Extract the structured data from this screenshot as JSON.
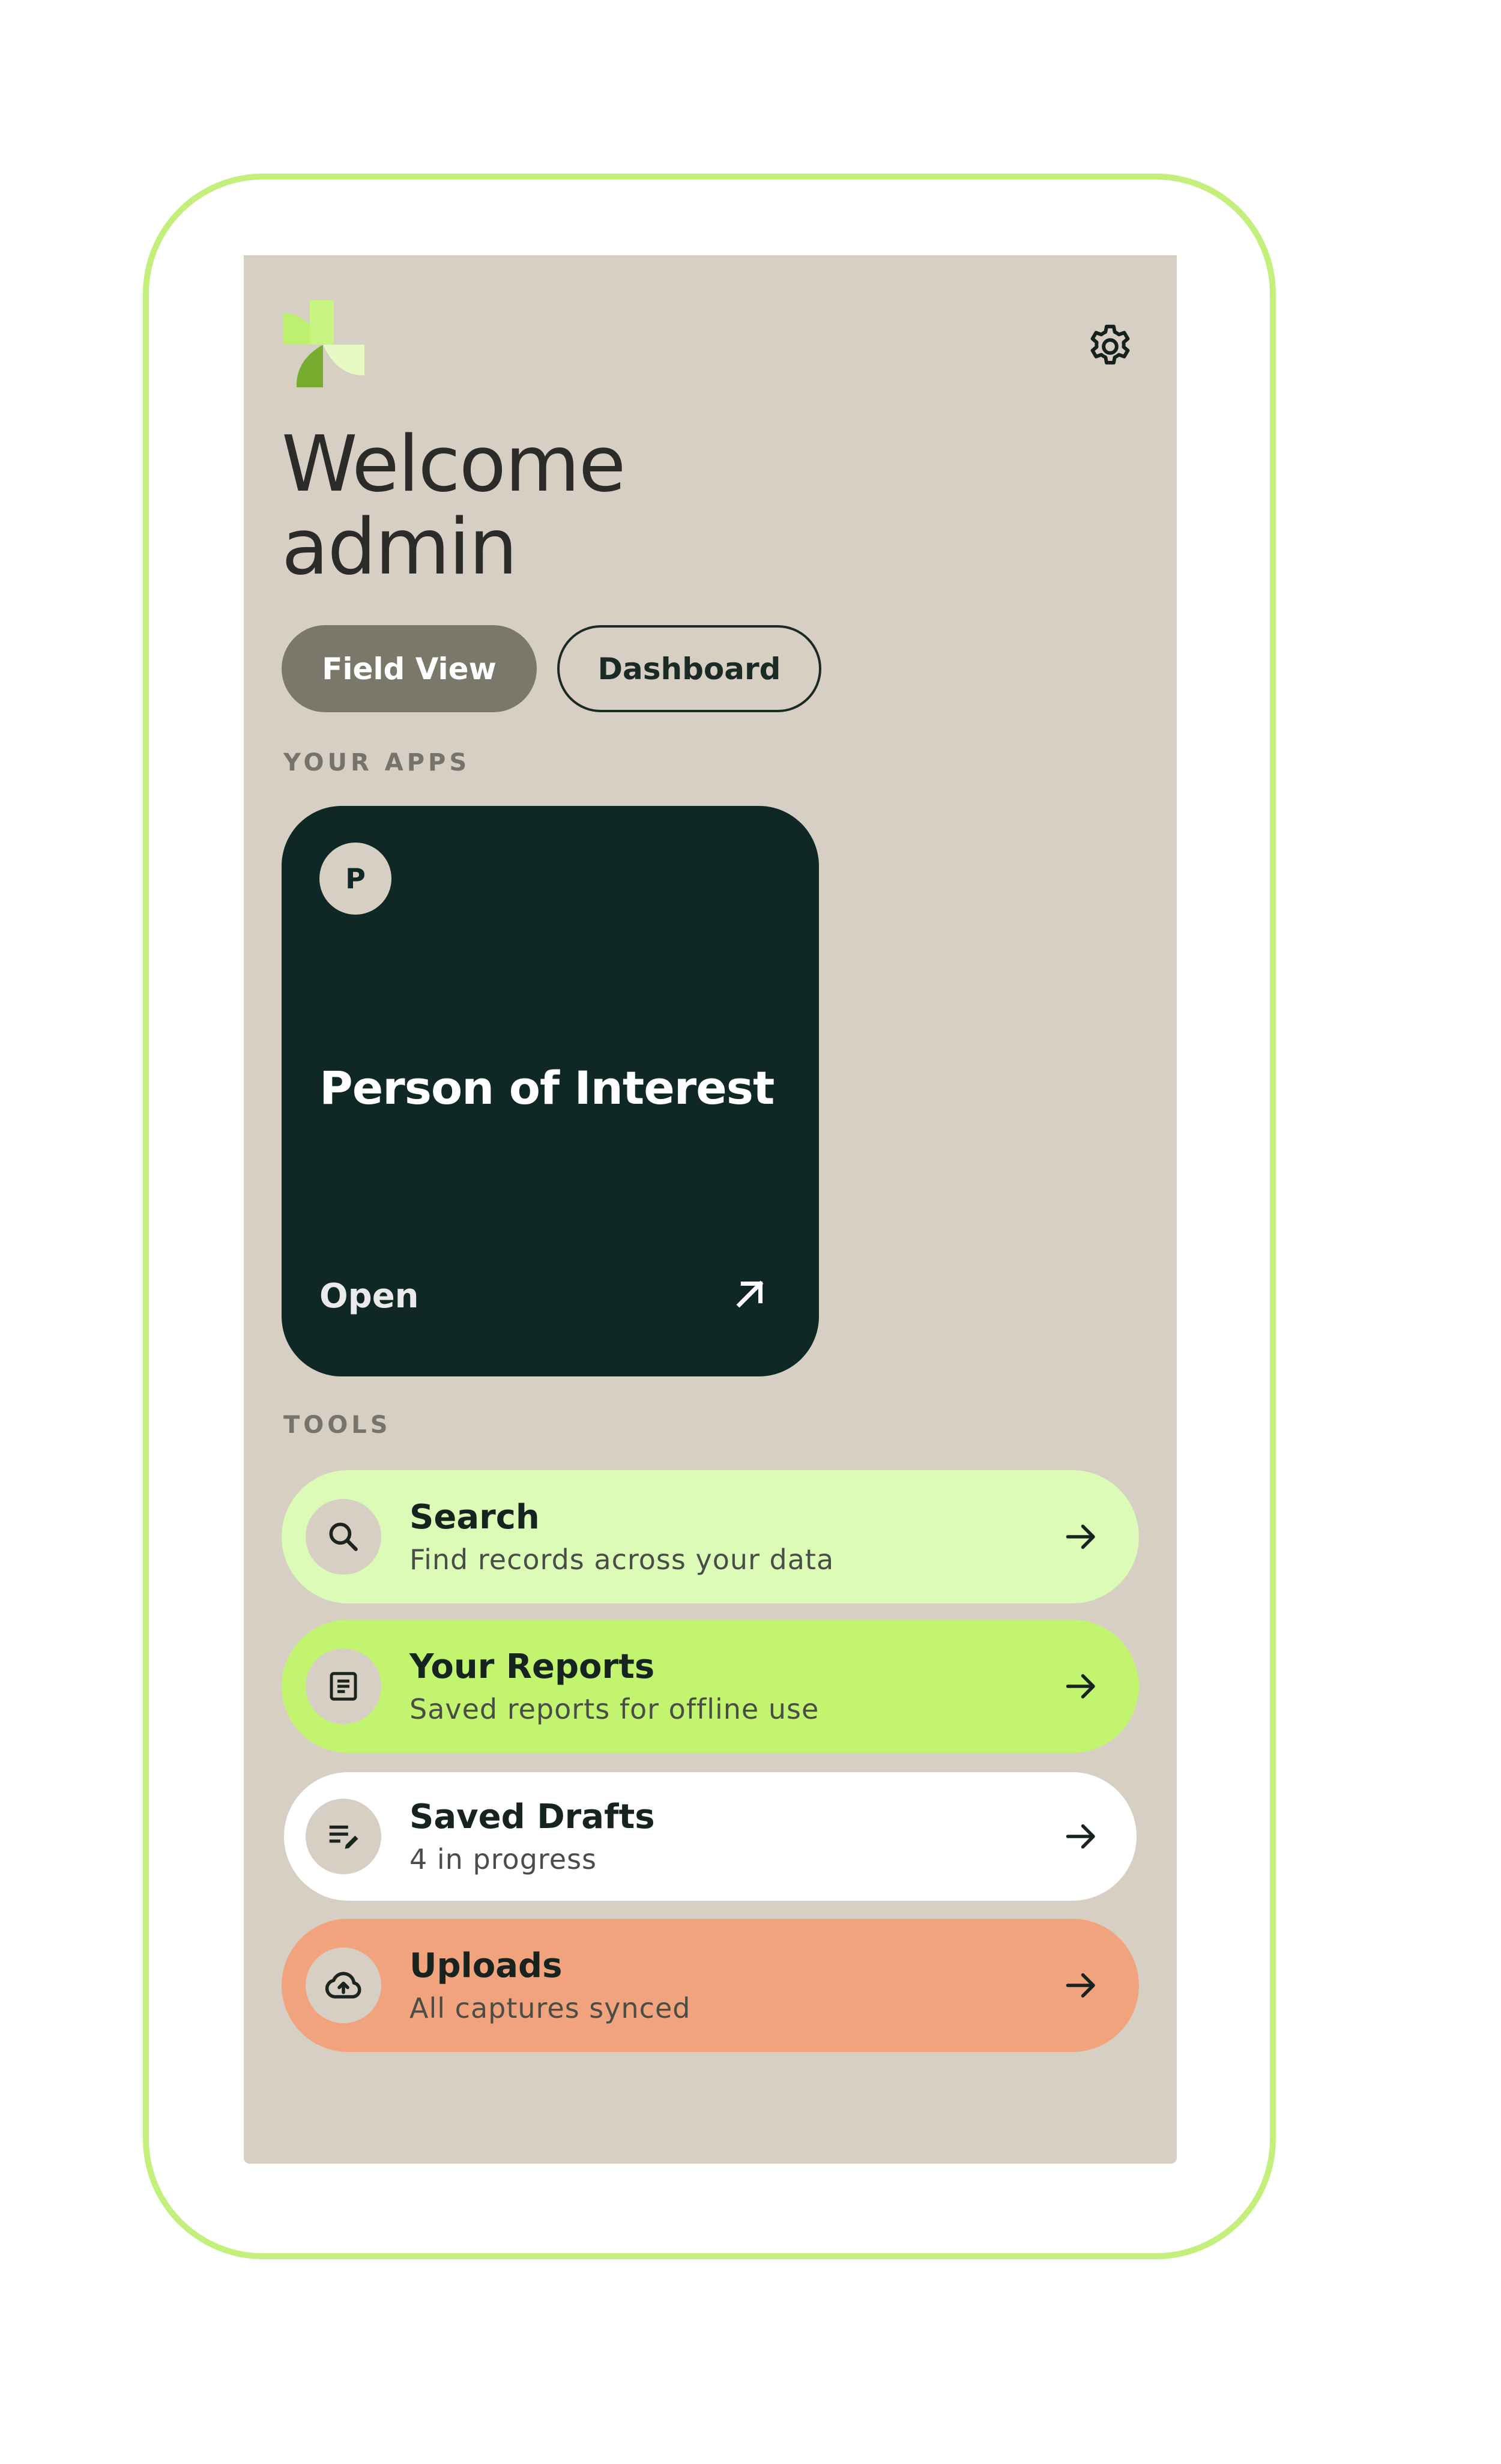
{
  "header": {
    "logo_icon": "pinwheel-logo-icon",
    "settings_icon": "gear-icon",
    "welcome_line1": "Welcome",
    "welcome_line2": "admin"
  },
  "view_toggle": {
    "field_view_label": "Field View",
    "dashboard_label": "Dashboard",
    "selected": "Field View"
  },
  "apps": {
    "section_label": "YOUR APPS",
    "items": [
      {
        "badge": "P",
        "title": "Person of Interest",
        "action_label": "Open",
        "action_icon": "arrow-up-right-icon"
      }
    ]
  },
  "tools": {
    "section_label": "TOOLS",
    "items": [
      {
        "title": "Search",
        "subtitle": "Find records across your data",
        "icon": "search-icon",
        "color": "#dbfbb6"
      },
      {
        "title": "Your Reports",
        "subtitle": "Saved reports for offline use",
        "icon": "document-icon",
        "color": "#c2f470"
      },
      {
        "title": "Saved Drafts",
        "subtitle": "4 in progress",
        "icon": "edit-list-icon",
        "color": "#ffffff"
      },
      {
        "title": "Uploads",
        "subtitle": "All captures synced",
        "icon": "cloud-upload-icon",
        "color": "#f0a37c"
      }
    ]
  },
  "colors": {
    "device_frame": "#c2f07a",
    "screen_bg": "#d7cfc4",
    "app_card_bg": "#0f2826",
    "selected_pill": "#7a776b"
  }
}
